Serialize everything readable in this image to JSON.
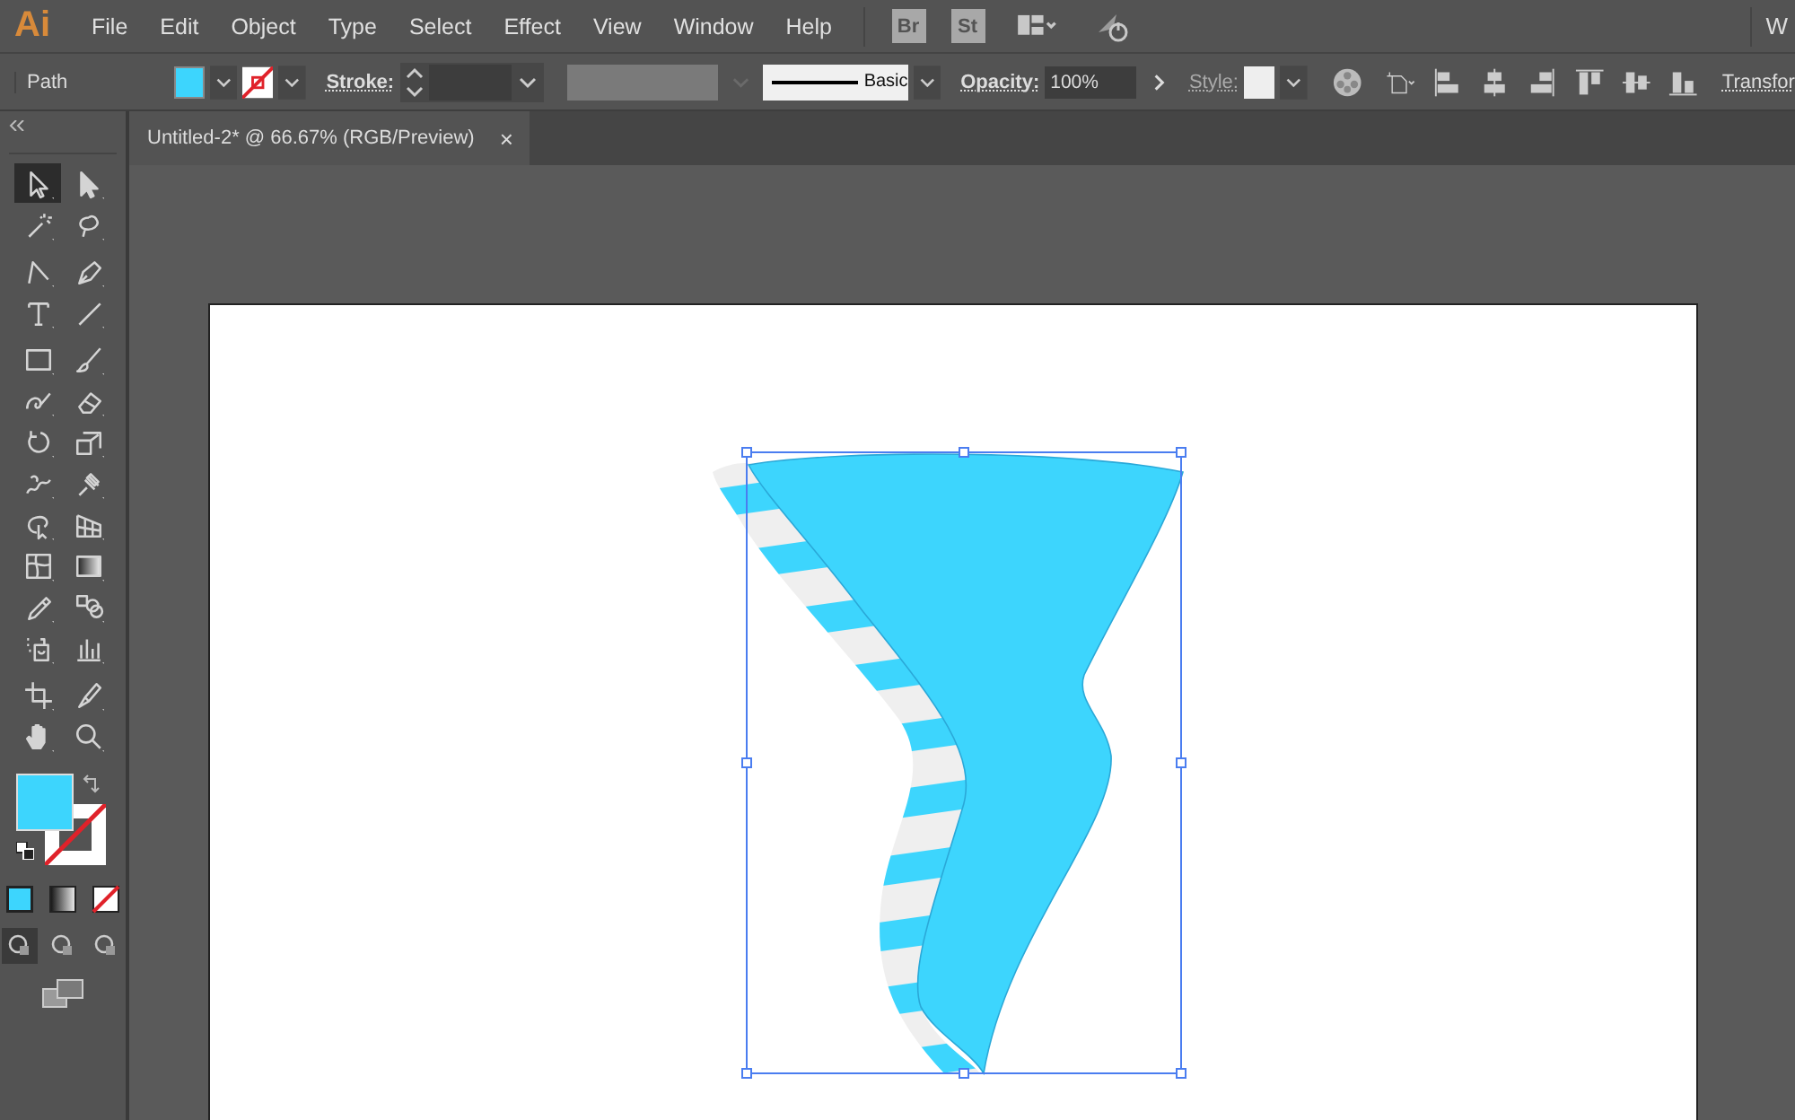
{
  "app_logo": "Ai",
  "menu": [
    "File",
    "Edit",
    "Object",
    "Type",
    "Select",
    "Effect",
    "View",
    "Window",
    "Help"
  ],
  "bridge_buttons": [
    "Br",
    "St"
  ],
  "workspace_label": "W",
  "control_bar": {
    "selection_label": "Path",
    "stroke_label": "Stroke:",
    "brush_label": "Basic",
    "opacity_label": "Opacity:",
    "opacity_value": "100%",
    "style_label": "Style:",
    "transform_label": "Transfor"
  },
  "document_tab": {
    "title": "Untitled-2* @ 66.67% (RGB/Preview)",
    "close": "×"
  },
  "tools": [
    {
      "kind": "selection",
      "selected": true
    },
    {
      "kind": "direct",
      "selected": false
    },
    {
      "kind": "wand",
      "selected": false
    },
    {
      "kind": "lasso",
      "selected": false
    },
    {
      "kind": "curvature",
      "selected": false
    },
    {
      "kind": "pen",
      "selected": false
    },
    {
      "kind": "type",
      "selected": false
    },
    {
      "kind": "line",
      "selected": false
    },
    {
      "kind": "rect",
      "selected": false
    },
    {
      "kind": "brush",
      "selected": false
    },
    {
      "kind": "shaper",
      "selected": false
    },
    {
      "kind": "eraser",
      "selected": false
    },
    {
      "kind": "rotate",
      "selected": false
    },
    {
      "kind": "scale",
      "selected": false
    },
    {
      "kind": "warp",
      "selected": false
    },
    {
      "kind": "pin",
      "selected": false
    },
    {
      "kind": "freetransform",
      "selected": false
    },
    {
      "kind": "perspective",
      "selected": false
    },
    {
      "kind": "mesh",
      "selected": false
    },
    {
      "kind": "gradient",
      "selected": false
    },
    {
      "kind": "eyedropper",
      "selected": false
    },
    {
      "kind": "blend",
      "selected": false
    },
    {
      "kind": "sprayer",
      "selected": false
    },
    {
      "kind": "graph",
      "selected": false
    },
    {
      "kind": "artboard",
      "selected": false
    },
    {
      "kind": "knife",
      "selected": false
    },
    {
      "kind": "hand",
      "selected": false
    },
    {
      "kind": "zoom",
      "selected": false
    }
  ],
  "draw_modes": [
    {
      "selected": true
    },
    {
      "selected": false
    },
    {
      "selected": false
    }
  ]
}
